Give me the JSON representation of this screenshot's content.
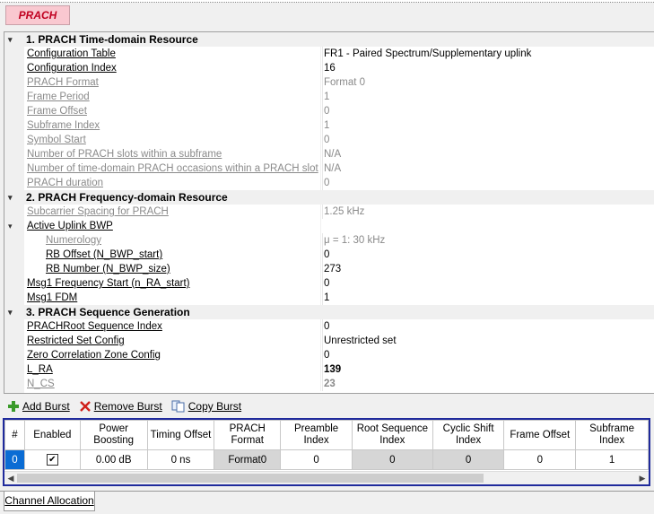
{
  "tab": {
    "label": "PRACH"
  },
  "sections": [
    {
      "title": "1. PRACH Time-domain Resource",
      "rows": [
        {
          "name": "Configuration Table",
          "value": "FR1 - Paired Spectrum/Supplementary uplink",
          "enabled": true
        },
        {
          "name": "Configuration Index",
          "value": "16",
          "enabled": true
        },
        {
          "name": "PRACH Format",
          "value": "Format 0",
          "enabled": false
        },
        {
          "name": "Frame Period",
          "value": "1",
          "enabled": false
        },
        {
          "name": "Frame Offset",
          "value": "0",
          "enabled": false
        },
        {
          "name": "Subframe Index",
          "value": "1",
          "enabled": false
        },
        {
          "name": "Symbol Start",
          "value": "0",
          "enabled": false
        },
        {
          "name": "Number of PRACH slots within a subframe",
          "value": "N/A",
          "enabled": false
        },
        {
          "name": "Number of time-domain PRACH occasions within a PRACH slot",
          "value": "N/A",
          "enabled": false
        },
        {
          "name": "PRACH duration",
          "value": "0",
          "enabled": false
        }
      ]
    },
    {
      "title": "2. PRACH Frequency-domain Resource",
      "rows": [
        {
          "name": "Subcarrier Spacing for PRACH",
          "value": "1.25 kHz",
          "enabled": false
        },
        {
          "name": "Active Uplink BWP",
          "value": "",
          "enabled": true,
          "group": true
        },
        {
          "name": "Numerology",
          "value": "μ = 1: 30 kHz",
          "enabled": false,
          "indent": true
        },
        {
          "name": "RB Offset (N_BWP_start)",
          "value": "0",
          "enabled": true,
          "indent": true
        },
        {
          "name": "RB Number (N_BWP_size)",
          "value": "273",
          "enabled": true,
          "indent": true
        },
        {
          "name": "Msg1 Frequency Start (n_RA_start)",
          "value": "0",
          "enabled": true
        },
        {
          "name": "Msg1 FDM",
          "value": "1",
          "enabled": true
        }
      ]
    },
    {
      "title": "3. PRACH Sequence Generation",
      "rows": [
        {
          "name": "PRACHRoot Sequence Index",
          "value": "0",
          "enabled": true
        },
        {
          "name": "Restricted Set Config",
          "value": "Unrestricted set",
          "enabled": true
        },
        {
          "name": "Zero Correlation Zone Config",
          "value": "0",
          "enabled": true
        },
        {
          "name": "L_RA",
          "value": "139",
          "enabled": true,
          "bold": true
        },
        {
          "name": "N_CS",
          "value": "23",
          "enabled": false,
          "bold": true
        }
      ]
    }
  ],
  "toolbar": {
    "add": "Add Burst",
    "remove": "Remove Burst",
    "copy": "Copy Burst"
  },
  "burst_table": {
    "columns": [
      "#",
      "Enabled",
      "Power Boosting",
      "Timing Offset",
      "PRACH Format",
      "Preamble Index",
      "Root Sequence Index",
      "Cyclic Shift Index",
      "Frame Offset",
      "Subframe Index"
    ],
    "rows": [
      {
        "index": "0",
        "enabled": "✔",
        "power": "0.00 dB",
        "timing": "0 ns",
        "format": "Format0",
        "preamble": "0",
        "root": "0",
        "cyclic": "0",
        "frame": "0",
        "subframe": "1"
      }
    ]
  },
  "bottom_tab": {
    "label": "Channel Allocation"
  },
  "colors": {
    "tab_bg": "#f9c8d0",
    "tab_text": "#c00020",
    "selection": "#0a6cd4",
    "grid_border": "#1f2a9c"
  }
}
